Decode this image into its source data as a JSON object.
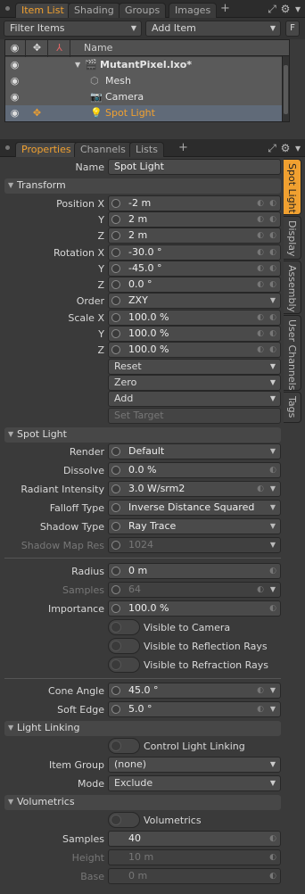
{
  "top_tabs": [
    "Item List",
    "Shading",
    "Groups",
    "Images"
  ],
  "prop_tabs": [
    "Properties",
    "Channels",
    "Lists"
  ],
  "plus": "+",
  "filter": {
    "label": "Filter Items",
    "add_item": "Add Item",
    "f_button": "F"
  },
  "tree": {
    "header_name": "Name",
    "items": [
      {
        "label": "MutantPixel.lxo*"
      },
      {
        "label": "Mesh"
      },
      {
        "label": "Camera"
      },
      {
        "label": "Spot Light"
      }
    ]
  },
  "side_tabs": [
    "Spot Light",
    "Display",
    "Assembly",
    "User Channels",
    "Tags"
  ],
  "name": {
    "label": "Name",
    "value": "Spot Light"
  },
  "transform": {
    "title": "Transform",
    "position": {
      "label": "Position X",
      "y": "Y",
      "z": "Z",
      "values": [
        "-2 m",
        "2 m",
        "2 m"
      ]
    },
    "rotation": {
      "label": "Rotation X",
      "y": "Y",
      "z": "Z",
      "values": [
        "-30.0 °",
        "-45.0 °",
        "0.0 °"
      ]
    },
    "order": {
      "label": "Order",
      "value": "ZXY"
    },
    "scale": {
      "label": "Scale X",
      "y": "Y",
      "z": "Z",
      "values": [
        "100.0 %",
        "100.0 %",
        "100.0 %"
      ]
    },
    "reset": "Reset",
    "zero": "Zero",
    "add": "Add",
    "set_target": "Set Target"
  },
  "spot": {
    "title": "Spot Light",
    "render": {
      "label": "Render",
      "value": "Default"
    },
    "dissolve": {
      "label": "Dissolve",
      "value": "0.0 %"
    },
    "radiant": {
      "label": "Radiant Intensity",
      "value": "3.0 W/srm2"
    },
    "falloff": {
      "label": "Falloff Type",
      "value": "Inverse Distance Squared"
    },
    "shadow_type": {
      "label": "Shadow Type",
      "value": "Ray Trace"
    },
    "shadow_res": {
      "label": "Shadow Map Res",
      "value": "1024"
    },
    "radius": {
      "label": "Radius",
      "value": "0 m"
    },
    "samples": {
      "label": "Samples",
      "value": "64"
    },
    "importance": {
      "label": "Importance",
      "value": "100.0 %"
    },
    "vis_camera": "Visible to Camera",
    "vis_reflection": "Visible to Reflection Rays",
    "vis_refraction": "Visible to Refraction Rays",
    "cone": {
      "label": "Cone Angle",
      "value": "45.0 °"
    },
    "soft": {
      "label": "Soft Edge",
      "value": "5.0 °"
    }
  },
  "linking": {
    "title": "Light Linking",
    "control": "Control Light Linking",
    "group": {
      "label": "Item Group",
      "value": "(none)"
    },
    "mode": {
      "label": "Mode",
      "value": "Exclude"
    }
  },
  "volumetrics": {
    "title": "Volumetrics",
    "toggle": "Volumetrics",
    "samples": {
      "label": "Samples",
      "value": "40"
    },
    "height": {
      "label": "Height",
      "value": "10 m"
    },
    "base": {
      "label": "Base",
      "value": "0 m"
    }
  },
  "colors": {
    "accent": "#f0a030",
    "selection": "#606a78",
    "panel": "#3a3a3a"
  }
}
